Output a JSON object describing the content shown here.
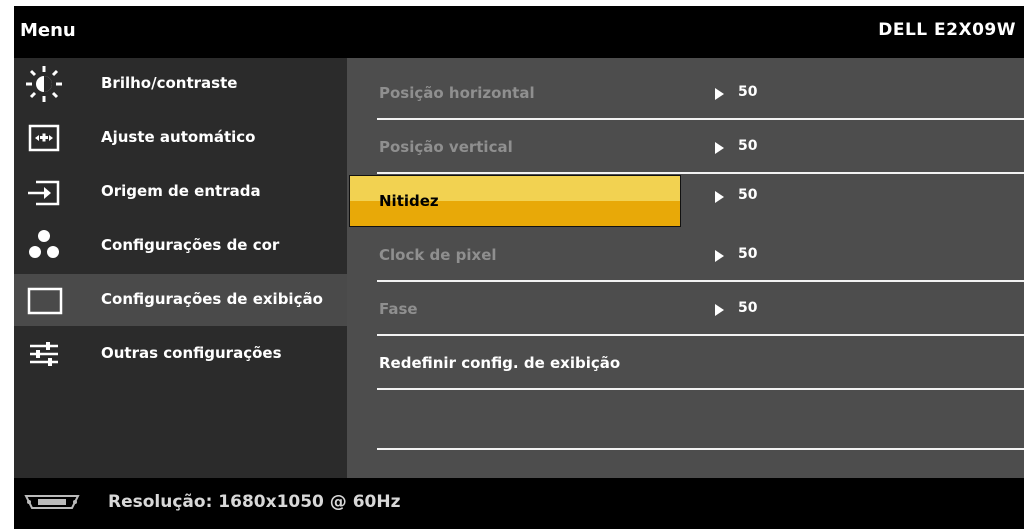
{
  "header": {
    "menu_title": "Menu",
    "model": "DELL E2X09W"
  },
  "sidebar": {
    "items": [
      {
        "label": "Brilho/contraste",
        "icon": "brightness-contrast-icon"
      },
      {
        "label": "Ajuste automático",
        "icon": "auto-adjust-icon"
      },
      {
        "label": "Origem de entrada",
        "icon": "input-source-icon"
      },
      {
        "label": "Configurações de cor",
        "icon": "color-settings-icon"
      },
      {
        "label": "Configurações de exibição",
        "icon": "display-settings-icon",
        "active": true
      },
      {
        "label": "Outras configurações",
        "icon": "other-settings-icon"
      }
    ]
  },
  "display_settings": {
    "rows": [
      {
        "label": "Posição horizontal",
        "value": "50"
      },
      {
        "label": "Posição vertical",
        "value": "50"
      },
      {
        "label": "Nitidez",
        "value": "50",
        "selected": true
      },
      {
        "label": "Clock de pixel",
        "value": "50"
      },
      {
        "label": "Fase",
        "value": "50"
      },
      {
        "label": "Redefinir config. de exibição"
      }
    ]
  },
  "footer": {
    "resolution_text": "Resolução: 1680x1050 @ 60Hz",
    "icon": "vga-connector-icon"
  },
  "colors": {
    "selection_top": "#f2d251",
    "selection_bottom": "#e8a908",
    "panel": "#4d4d4d",
    "sidebar": "#2b2b2b"
  }
}
